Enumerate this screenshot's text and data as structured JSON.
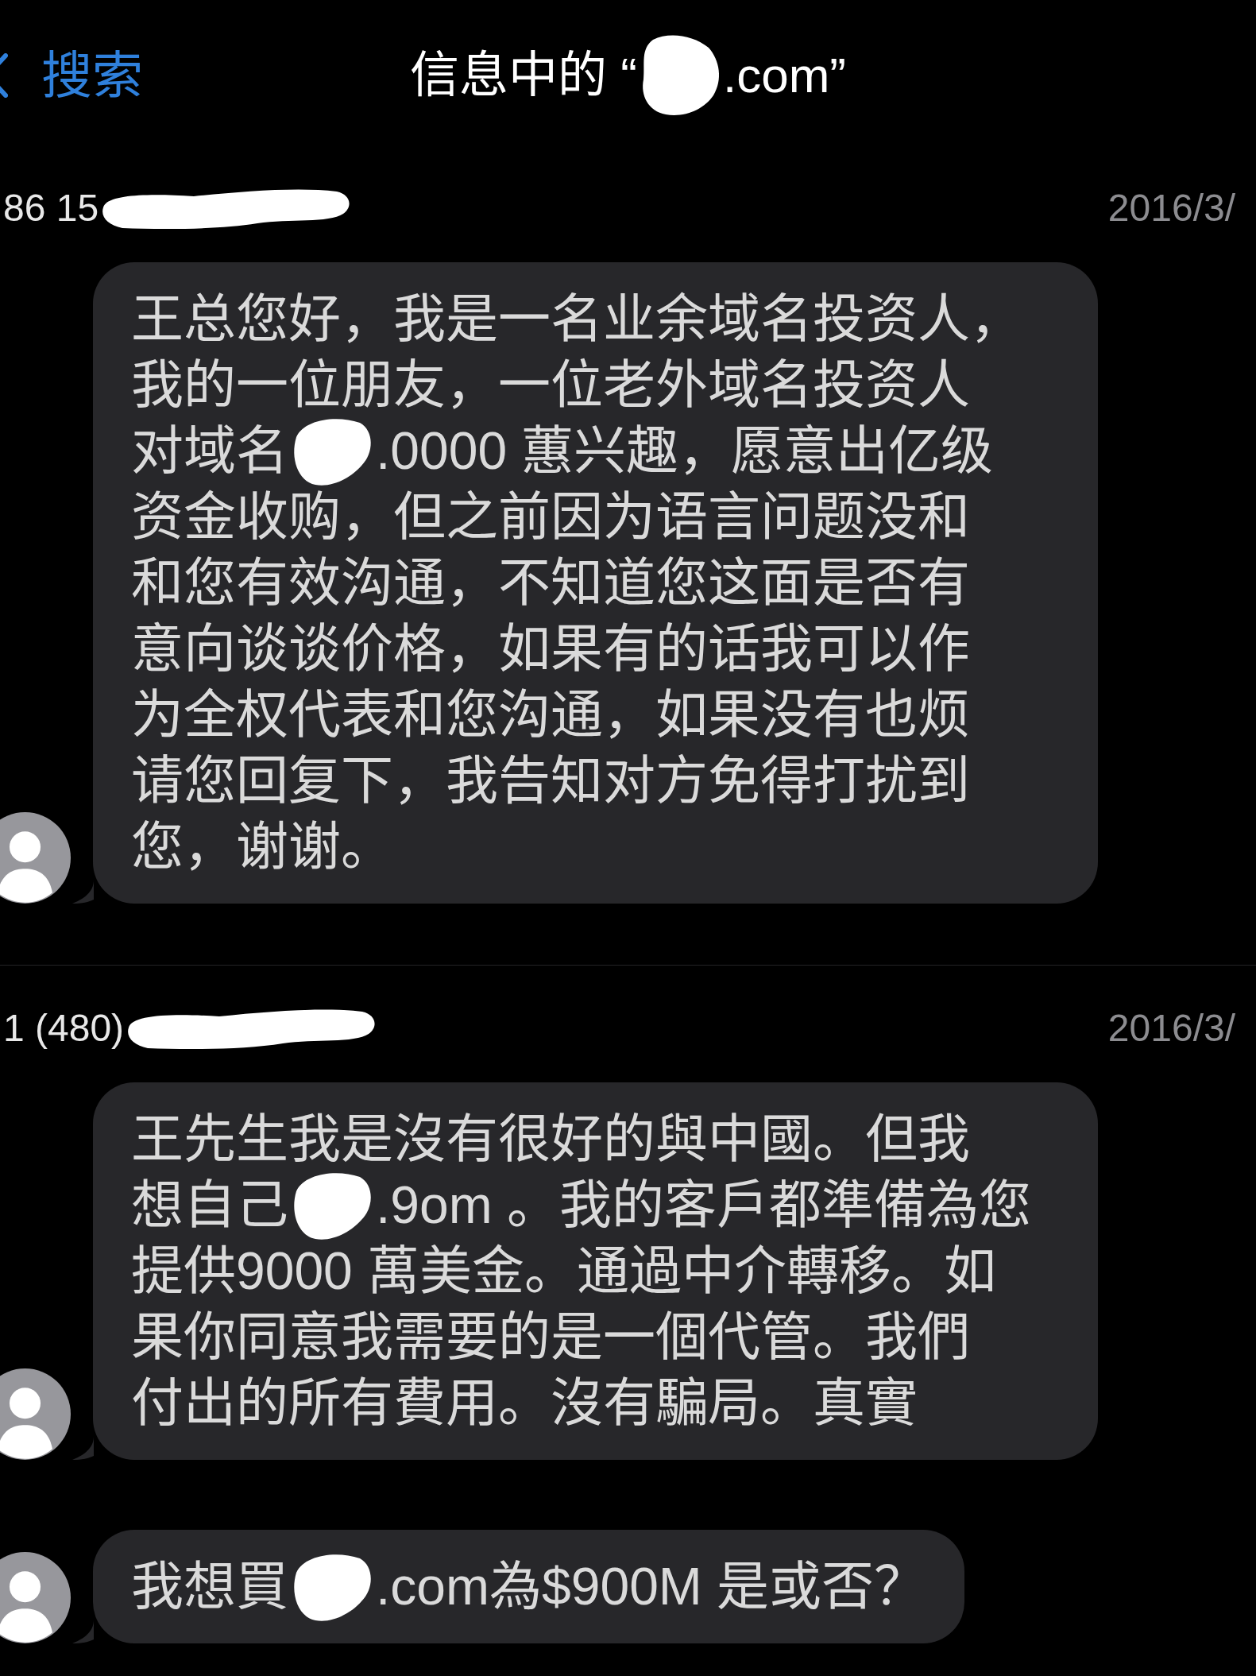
{
  "header": {
    "back_label": "搜索",
    "title": [
      {
        "kind": "text",
        "text": "信息中的 “"
      },
      {
        "kind": "redaction"
      },
      {
        "kind": "text",
        "text": ".com”"
      }
    ]
  },
  "conversations": [
    {
      "sender": [
        {
          "kind": "text",
          "text": "86 15"
        },
        {
          "kind": "redaction"
        }
      ],
      "date": "2016/3/",
      "messages": [
        {
          "lines": [
            [
              {
                "kind": "text",
                "text": "王总您好，我是一名业余域名投资人，"
              }
            ],
            [
              {
                "kind": "text",
                "text": "我的一位朋友，一位老外域名投资人"
              }
            ],
            [
              {
                "kind": "text",
                "text": "对域名"
              },
              {
                "kind": "redaction"
              },
              {
                "kind": "text",
                "text": ".0000 蕙兴趣，愿意出亿级"
              }
            ],
            [
              {
                "kind": "text",
                "text": "资金收购，但之前因为语言问题没和"
              }
            ],
            [
              {
                "kind": "text",
                "text": "和您有效沟通，不知道您这面是否有"
              }
            ],
            [
              {
                "kind": "text",
                "text": "意向谈谈价格，如果有的话我可以作"
              }
            ],
            [
              {
                "kind": "text",
                "text": "为全权代表和您沟通，如果没有也烦"
              }
            ],
            [
              {
                "kind": "text",
                "text": "请您回复下，我告知对方免得打扰到"
              }
            ],
            [
              {
                "kind": "text",
                "text": "您，谢谢。"
              }
            ]
          ]
        }
      ]
    },
    {
      "sender": [
        {
          "kind": "text",
          "text": "1 (480)"
        },
        {
          "kind": "redaction"
        }
      ],
      "date": "2016/3/",
      "messages": [
        {
          "lines": [
            [
              {
                "kind": "text",
                "text": "王先生我是沒有很好的與中國。但我"
              }
            ],
            [
              {
                "kind": "text",
                "text": "想自己"
              },
              {
                "kind": "redaction"
              },
              {
                "kind": "text",
                "text": ".9om 。我的客戶都準備為您"
              }
            ],
            [
              {
                "kind": "text",
                "text": "提供9000 萬美金。通過中介轉移。如"
              }
            ],
            [
              {
                "kind": "text",
                "text": "果你同意我需要的是一個代管。我們"
              }
            ],
            [
              {
                "kind": "text",
                "text": "付出的所有費用。沒有騙局。真實"
              }
            ]
          ]
        },
        {
          "lines": [
            [
              {
                "kind": "text",
                "text": "我想買"
              },
              {
                "kind": "redaction"
              },
              {
                "kind": "text",
                "text": ".com為$900M 是或否？"
              }
            ]
          ]
        }
      ]
    }
  ]
}
